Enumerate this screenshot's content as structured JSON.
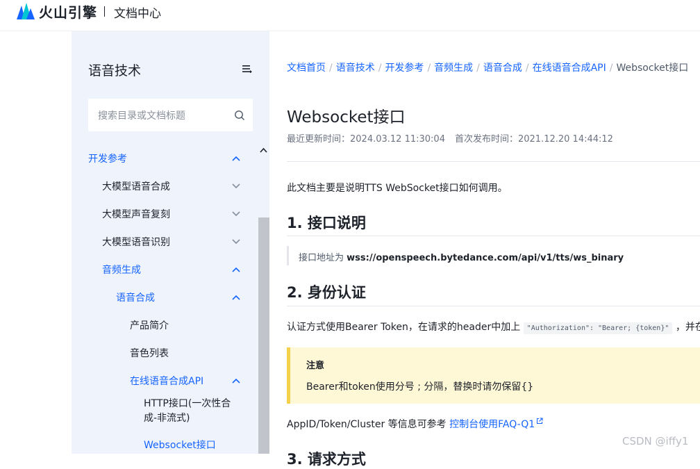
{
  "brand": {
    "logo_text": "火山引擎",
    "section": "文档中心",
    "logo_color": "#1664ff"
  },
  "sidebar": {
    "title": "语音技术",
    "search_placeholder": "搜索目录或文档标题",
    "items": [
      {
        "label": "开发参考",
        "state": "active",
        "chevron": "up"
      },
      {
        "label": "大模型语音合成",
        "state": "normal",
        "chevron": "down"
      },
      {
        "label": "大模型声音复刻",
        "state": "normal",
        "chevron": "down"
      },
      {
        "label": "大模型语音识别",
        "state": "normal",
        "chevron": "down"
      },
      {
        "label": "音频生成",
        "state": "active",
        "chevron": "up"
      },
      {
        "label": "语音合成",
        "state": "active",
        "chevron": "up"
      },
      {
        "label": "产品简介",
        "state": "normal",
        "chevron": ""
      },
      {
        "label": "音色列表",
        "state": "normal",
        "chevron": ""
      },
      {
        "label": "在线语音合成API",
        "state": "active",
        "chevron": "up"
      },
      {
        "label": "HTTP接口(一次性合成-非流式)",
        "line1": "HTTP接口(一次性合",
        "line2": "成-非流式)",
        "state": "normal",
        "chevron": ""
      },
      {
        "label": "Websocket接口",
        "state": "active",
        "chevron": ""
      }
    ]
  },
  "breadcrumb": [
    {
      "label": "文档首页",
      "current": false
    },
    {
      "label": "语音技术",
      "current": false
    },
    {
      "label": "开发参考",
      "current": false
    },
    {
      "label": "音频生成",
      "current": false
    },
    {
      "label": "语音合成",
      "current": false
    },
    {
      "label": "在线语音合成API",
      "current": false
    },
    {
      "label": "Websocket接口",
      "current": true
    }
  ],
  "breadcrumb_sep": "/",
  "page": {
    "title": "Websocket接口",
    "updated_label": "最近更新时间：",
    "updated_value": "2024.03.12 11:30:04",
    "published_label": "首次发布时间：",
    "published_value": "2021.12.20 14:44:12",
    "intro": "此文档主要是说明TTS WebSocket接口如何调用。",
    "section1_title": "1. 接口说明",
    "endpoint_prefix": "接口地址为 ",
    "endpoint_url": "wss://openspeech.bytedance.com/api/v1/tts/ws_binary",
    "section2_title": "2. 身份认证",
    "auth_text_before": "认证方式使用Bearer Token，在请求的header中加上 ",
    "auth_code": "\"Authorization\": \"Bearer; {token}\"",
    "auth_text_after": " ，并在请",
    "note_title": "注意",
    "note_body": "Bearer和token使用分号 ; 分隔，替换时请勿保留{}",
    "appid_text": "AppID/Token/Cluster 等信息可参考 ",
    "appid_link": "控制台使用FAQ-Q1",
    "section3_title": "3. 请求方式"
  },
  "watermark": "CSDN @iffy1"
}
